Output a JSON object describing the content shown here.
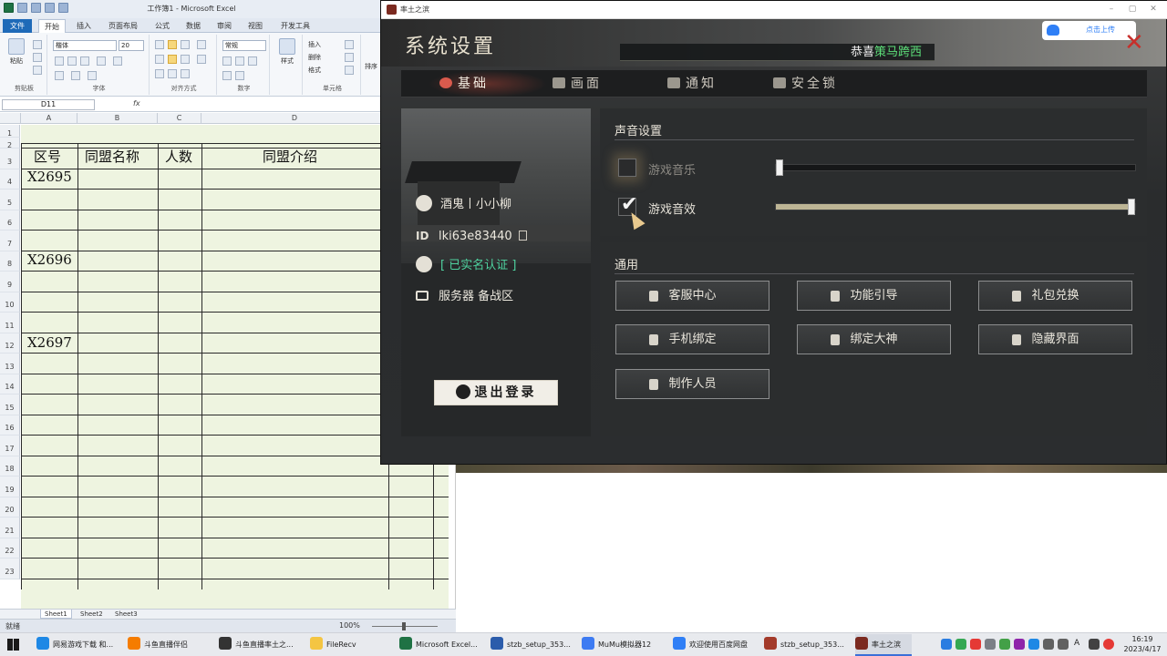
{
  "excel": {
    "window_title": "工作簿1 - Microsoft Excel",
    "tabs": [
      "文件",
      "开始",
      "插入",
      "页面布局",
      "公式",
      "数据",
      "审阅",
      "视图",
      "开发工具"
    ],
    "ribbon": {
      "paste": "粘贴",
      "font_name": "楷体",
      "font_size": "20",
      "number_format": "常规",
      "style": "样式",
      "insert": "插入",
      "delete": "删除",
      "format": "格式",
      "sort": "排序",
      "groups": [
        "剪贴板",
        "字体",
        "对齐方式",
        "数字",
        "单元格"
      ]
    },
    "name_box": "D11",
    "fx": "fx",
    "columns": [
      "A",
      "B",
      "C",
      "D"
    ],
    "rows": [
      "1",
      "2",
      "3",
      "4",
      "5",
      "6",
      "7",
      "8",
      "9",
      "10",
      "11",
      "12",
      "13",
      "14",
      "15",
      "16",
      "17",
      "18",
      "19",
      "20",
      "21",
      "22",
      "23"
    ],
    "headers": {
      "zone": "区号",
      "name": "同盟名称",
      "count": "人数",
      "intro": "同盟介绍"
    },
    "zones": [
      "X2695",
      "X2696",
      "X2697"
    ],
    "sheets": [
      "Sheet1",
      "Sheet2",
      "Sheet3"
    ],
    "status": "就绪",
    "zoom": "100%"
  },
  "game": {
    "window_title": "率土之滨",
    "settings_title": "系统设置",
    "congrats_prefix": "恭喜",
    "congrats_name": "策马跨西",
    "upload_label": "点击上传",
    "close": "✕",
    "tabs": [
      {
        "label": "基础",
        "icon": "home-icon"
      },
      {
        "label": "画面",
        "icon": "screen-icon"
      },
      {
        "label": "通知",
        "icon": "chat-icon"
      },
      {
        "label": "安全锁",
        "icon": "lock-icon"
      }
    ],
    "player": {
      "name": "酒鬼丨小小柳",
      "id_tag": "ID",
      "id": "lki63e83440",
      "verified": "[ 已实名认证 ]",
      "server": "服务器 备战区"
    },
    "logout": "退出登录",
    "sound": {
      "title": "声音设置",
      "music_label": "游戏音乐",
      "music_checked": false,
      "music_level": 0.0,
      "sfx_label": "游戏音效",
      "sfx_checked": true,
      "sfx_level": 1.0
    },
    "general": {
      "title": "通用",
      "buttons": [
        {
          "label": "客服中心",
          "icon": "phone-icon"
        },
        {
          "label": "功能引导",
          "icon": "pointer-icon"
        },
        {
          "label": "礼包兑换",
          "icon": "gift-icon"
        },
        {
          "label": "手机绑定",
          "icon": "mobile-icon"
        },
        {
          "label": "绑定大神",
          "icon": "god-icon"
        },
        {
          "label": "隐藏界面",
          "icon": "collapse-icon"
        },
        {
          "label": "制作人员",
          "icon": "credits-icon"
        }
      ]
    }
  },
  "taskbar": {
    "items": [
      {
        "label": "网易游戏下载 和...",
        "color": "#1e88e5"
      },
      {
        "label": "斗鱼直播伴侣",
        "color": "#f57c00"
      },
      {
        "label": "斗鱼直播率土之...",
        "color": "#333333"
      },
      {
        "label": "FileRecv",
        "color": "#f4c542"
      },
      {
        "label": "Microsoft Excel...",
        "color": "#1f7244"
      },
      {
        "label": "stzb_setup_353...",
        "color": "#2b5cab"
      },
      {
        "label": "MuMu模拟器12",
        "color": "#3d7bf2"
      },
      {
        "label": "欢迎使用百度网盘",
        "color": "#2f7ff6"
      },
      {
        "label": "stzb_setup_353...",
        "color": "#a33a2a"
      },
      {
        "label": "率土之滨",
        "color": "#7b2a20"
      }
    ],
    "ime": "A",
    "time": "16:19",
    "date": "2023/4/17"
  }
}
